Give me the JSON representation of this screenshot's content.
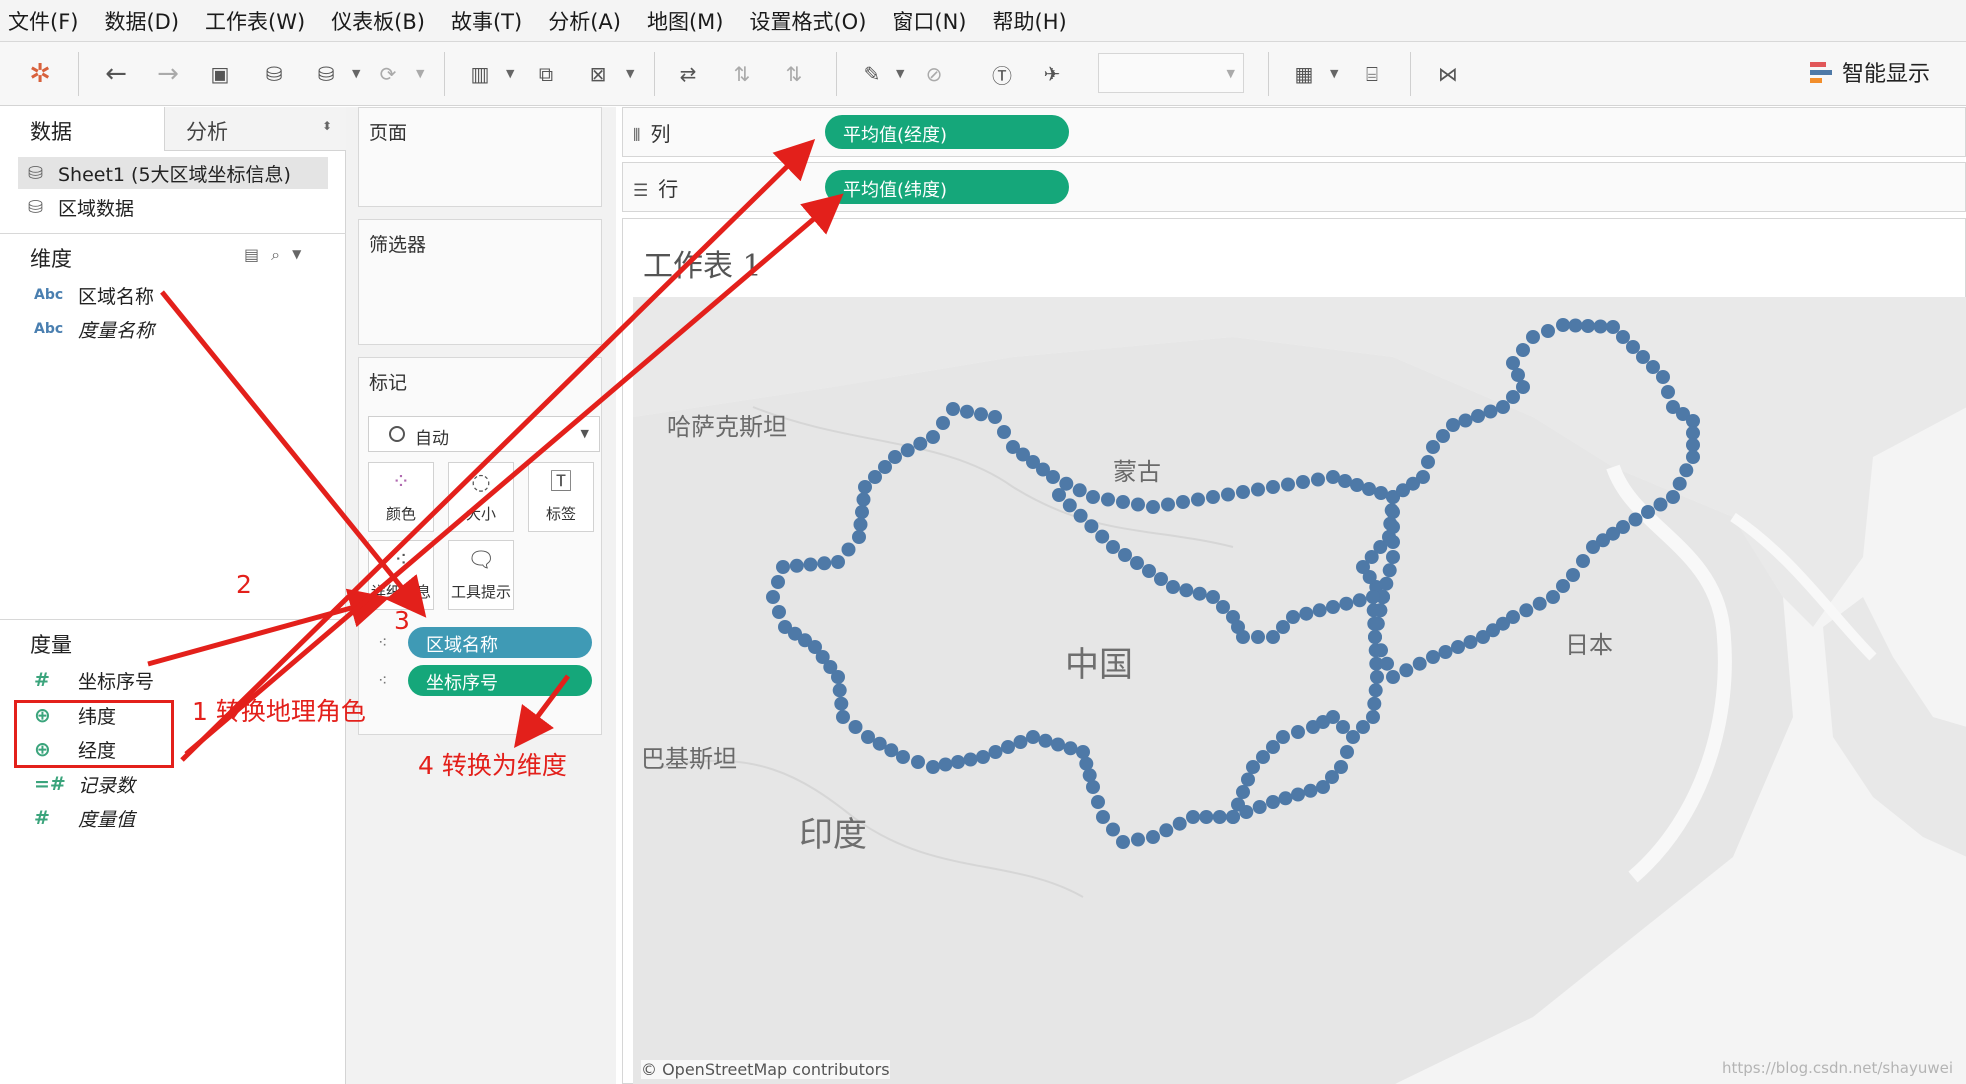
{
  "menu": [
    "文件(F)",
    "数据(D)",
    "工作表(W)",
    "仪表板(B)",
    "故事(T)",
    "分析(A)",
    "地图(M)",
    "设置格式(O)",
    "窗口(N)",
    "帮助(H)"
  ],
  "toolbar": {
    "smart_show": "智能显示",
    "colors": {
      "smart_bars": [
        "#e15759",
        "#4e79a7",
        "#f28e2b"
      ]
    }
  },
  "left_pane": {
    "tab_data": "数据",
    "tab_analysis": "分析",
    "datasources": [
      "Sheet1 (5大区域坐标信息)",
      "区域数据"
    ],
    "dimensions_title": "维度",
    "dimensions": [
      {
        "type": "Abc",
        "label": "区域名称",
        "italic": false
      },
      {
        "type": "Abc",
        "label": "度量名称",
        "italic": true
      }
    ],
    "measures_title": "度量",
    "measures": [
      {
        "type": "#",
        "label": "坐标序号",
        "italic": false
      },
      {
        "type": "globe",
        "label": "纬度",
        "italic": false
      },
      {
        "type": "globe",
        "label": "经度",
        "italic": false
      },
      {
        "type": "=#",
        "label": "记录数",
        "italic": true
      },
      {
        "type": "#",
        "label": "度量值",
        "italic": true
      }
    ]
  },
  "cards": {
    "pages": "页面",
    "filters": "筛选器",
    "marks": "标记",
    "mark_type": "自动",
    "buttons": {
      "color": "颜色",
      "size": "大小",
      "label": "标签",
      "detail": "详细信息",
      "tooltip": "工具提示"
    },
    "mark_pills": [
      "区域名称",
      "坐标序号"
    ]
  },
  "shelves": {
    "columns_label": "列",
    "columns_pill": "平均值(经度)",
    "rows_label": "行",
    "rows_pill": "平均值(纬度)"
  },
  "sheet": {
    "title": "工作表 1",
    "map_labels": {
      "kazakhstan": "哈萨克斯坦",
      "mongolia": "蒙古",
      "china": "中国",
      "japan": "日本",
      "pakistan": "巴基斯坦",
      "india": "印度"
    },
    "attribution": "© OpenStreetMap contributors",
    "watermark": "https://blog.csdn.net/shayuwei",
    "colors": {
      "marks": "#4e79a7",
      "land": "#e6e6e6",
      "water": "#f7f7f7"
    }
  },
  "annotations": {
    "step1": "1 转换地理角色",
    "step2": "2",
    "step3": "3",
    "step4": "4 转换为维度",
    "color": "#e3201b"
  }
}
